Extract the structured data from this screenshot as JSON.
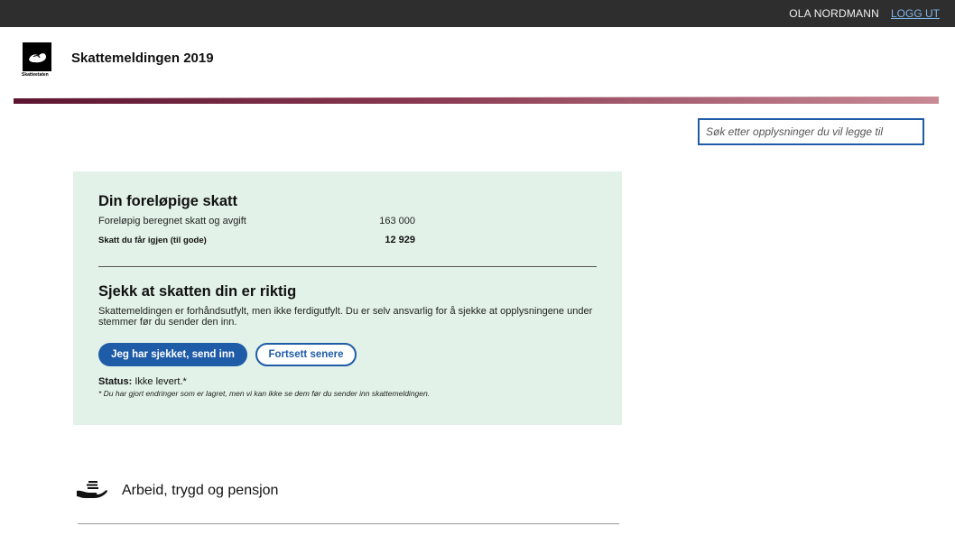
{
  "topbar": {
    "user_name": "OLA NORDMANN",
    "logout_label": "LOGG UT"
  },
  "header": {
    "logo_caption": "Skatteetaten",
    "app_title": "Skattemeldingen 2019"
  },
  "search": {
    "placeholder": "Søk etter opplysninger du vil legge til"
  },
  "tax_summary": {
    "title": "Din foreløpige skatt",
    "rows": [
      {
        "label": "Foreløpig beregnet skatt og avgift",
        "value": "163 000"
      },
      {
        "label": "Skatt du får igjen (til gode)",
        "value": "12 929"
      }
    ]
  },
  "check": {
    "title": "Sjekk at skatten din er riktig",
    "description": "Skattemeldingen er forhåndsutfylt, men ikke ferdigutfylt. Du er selv ansvarlig for å sjekke at opplysningene under stemmer før du sender den inn.",
    "submit_label": "Jeg har sjekket, send inn",
    "later_label": "Fortsett senere",
    "status_label": "Status:",
    "status_value": " Ikke levert.*",
    "note": "* Du har gjort endringer som er lagret, men vi kan ikke se dem før du sender inn skattemeldingen."
  },
  "sections": [
    {
      "label": "Arbeid, trygd og pensjon",
      "icon": "hand-coins-icon"
    }
  ],
  "colors": {
    "topbar": "#2e2e2e",
    "accent_blue": "#1f5ca8",
    "panel_bg": "#e2f2e8",
    "band_dark": "#5c1530",
    "band_light": "#c88a95"
  }
}
